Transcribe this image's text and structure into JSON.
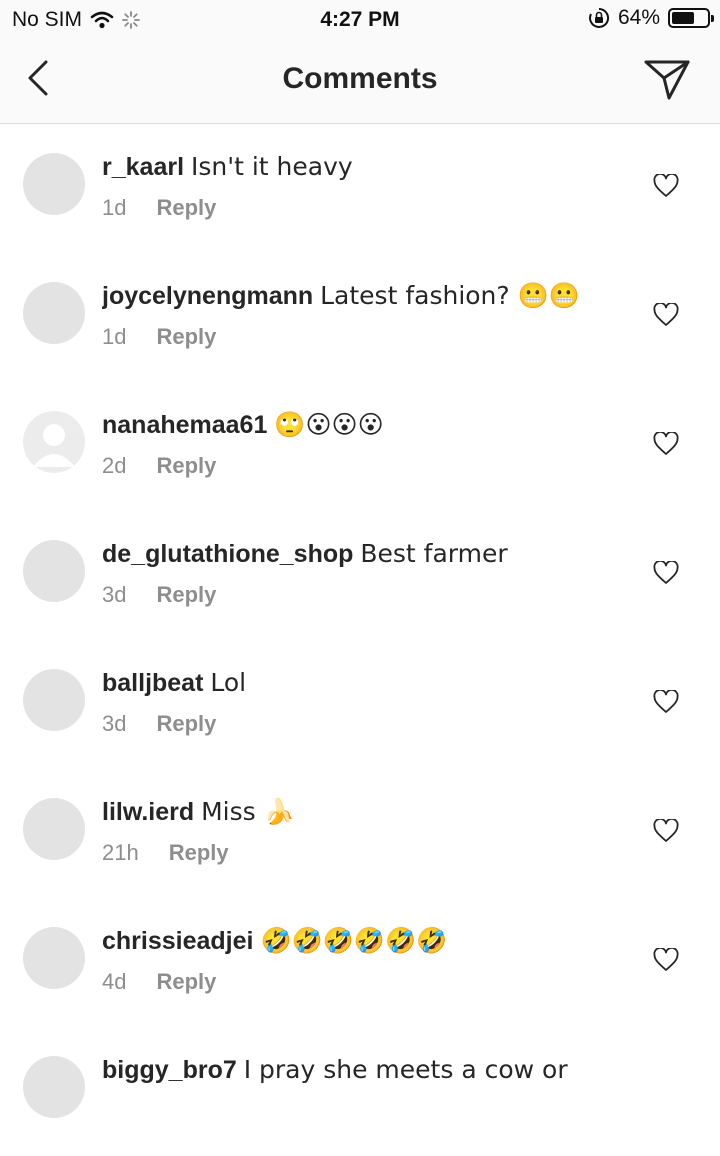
{
  "status": {
    "carrier": "No SIM",
    "time": "4:27 PM",
    "battery_text": "64%",
    "battery_level": 0.64
  },
  "header": {
    "title": "Comments"
  },
  "comments": [
    {
      "username": "r_kaarl",
      "text": "Isn't it heavy",
      "age": "1d",
      "reply": "Reply"
    },
    {
      "username": "joycelynengmann",
      "text": "Latest fashion? 😬😬",
      "age": "1d",
      "reply": "Reply"
    },
    {
      "username": "nanahemaa61",
      "text": "🙄😮😮😮",
      "age": "2d",
      "reply": "Reply"
    },
    {
      "username": "de_glutathione_shop",
      "text": "Best farmer",
      "age": "3d",
      "reply": "Reply"
    },
    {
      "username": "balljbeat",
      "text": "Lol",
      "age": "3d",
      "reply": "Reply"
    },
    {
      "username": "lilw.ierd",
      "text": "Miss 🍌",
      "age": "21h",
      "reply": "Reply"
    },
    {
      "username": "chrissieadjei",
      "text": "🤣🤣🤣🤣🤣🤣",
      "age": "4d",
      "reply": "Reply"
    },
    {
      "username": "biggy_bro7",
      "text": "I pray she meets a cow or",
      "age": "",
      "reply": ""
    }
  ]
}
